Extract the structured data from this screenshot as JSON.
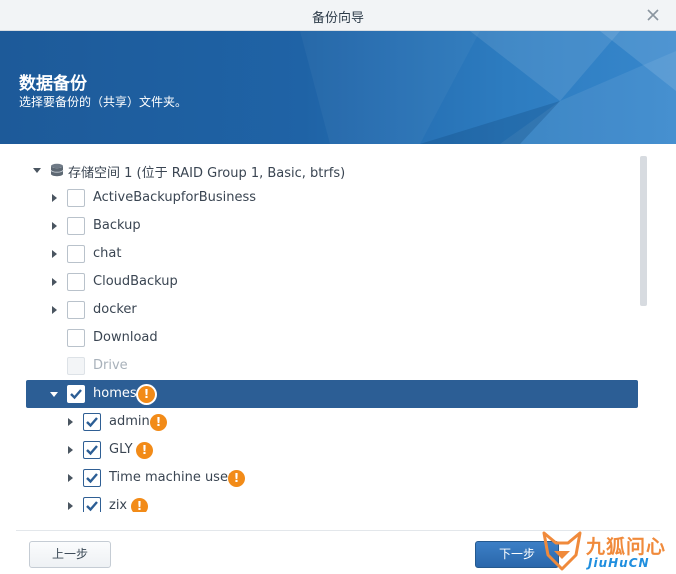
{
  "window": {
    "title": "备份向导"
  },
  "banner": {
    "title": "数据备份",
    "subtitle": "选择要备份的（共享）文件夹。"
  },
  "tree": {
    "root": {
      "label": "存储空间 1 (位于 RAID Group 1, Basic, btrfs)",
      "expanded": true
    },
    "items": [
      {
        "label": "ActiveBackupforBusiness",
        "checked": false,
        "expandable": true,
        "disabled": false,
        "warning": false
      },
      {
        "label": "Backup",
        "checked": false,
        "expandable": true,
        "disabled": false,
        "warning": false
      },
      {
        "label": "chat",
        "checked": false,
        "expandable": true,
        "disabled": false,
        "warning": false
      },
      {
        "label": "CloudBackup",
        "checked": false,
        "expandable": true,
        "disabled": false,
        "warning": false
      },
      {
        "label": "docker",
        "checked": false,
        "expandable": true,
        "disabled": false,
        "warning": false
      },
      {
        "label": "Download",
        "checked": false,
        "expandable": false,
        "disabled": false,
        "warning": false
      },
      {
        "label": "Drive",
        "checked": false,
        "expandable": false,
        "disabled": true,
        "warning": false
      },
      {
        "label": "homes",
        "checked": true,
        "expandable": true,
        "expanded": true,
        "selected": true,
        "warning": true,
        "children": [
          {
            "label": "admin",
            "checked": true,
            "warning": true
          },
          {
            "label": "GLY",
            "checked": true,
            "warning": true
          },
          {
            "label": "Time machine user",
            "checked": true,
            "warning": true
          },
          {
            "label": "zix",
            "checked": true,
            "warning": true
          }
        ]
      }
    ],
    "warning_glyph": "!"
  },
  "footer": {
    "prev_label": "上一步",
    "next_label": "下一步"
  },
  "watermark": {
    "cn": "九狐问心",
    "en": "JiuHuCN"
  },
  "colors": {
    "banner": "#1f63a6",
    "selection": "#2c5e95",
    "warning": "#f28b18",
    "primary_button": "#2a67ab"
  },
  "icons": {
    "close": "close-icon",
    "expand": "triangle-right-icon",
    "collapse": "triangle-down-icon",
    "volume": "database-icon",
    "warning": "warning-icon"
  }
}
